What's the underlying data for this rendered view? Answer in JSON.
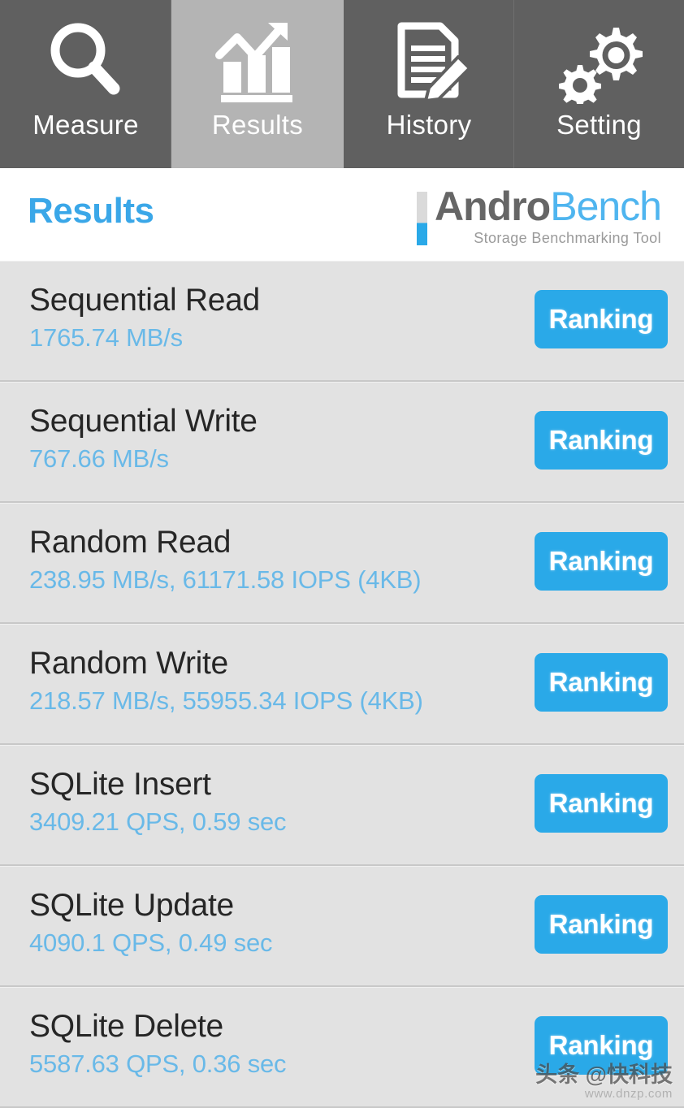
{
  "tabs": [
    {
      "label": "Measure",
      "icon": "magnifier-icon",
      "active": false
    },
    {
      "label": "Results",
      "icon": "bar-chart-trend-icon",
      "active": true
    },
    {
      "label": "History",
      "icon": "document-pencil-icon",
      "active": false
    },
    {
      "label": "Setting",
      "icon": "gears-icon",
      "active": false
    }
  ],
  "header": {
    "title": "Results",
    "logo_primary": "Andro",
    "logo_secondary": "Bench",
    "logo_tagline": "Storage Benchmarking Tool"
  },
  "results": [
    {
      "name": "Sequential Read",
      "value": "1765.74 MB/s",
      "button": "Ranking"
    },
    {
      "name": "Sequential Write",
      "value": "767.66 MB/s",
      "button": "Ranking"
    },
    {
      "name": "Random Read",
      "value": "238.95 MB/s, 61171.58 IOPS (4KB)",
      "button": "Ranking"
    },
    {
      "name": "Random Write",
      "value": "218.57 MB/s, 55955.34 IOPS (4KB)",
      "button": "Ranking"
    },
    {
      "name": "SQLite Insert",
      "value": "3409.21 QPS, 0.59 sec",
      "button": "Ranking"
    },
    {
      "name": "SQLite Update",
      "value": "4090.1 QPS, 0.49 sec",
      "button": "Ranking"
    },
    {
      "name": "SQLite Delete",
      "value": "5587.63 QPS, 0.36 sec",
      "button": "Ranking"
    }
  ],
  "watermark": {
    "main": "头条 @快科技",
    "sub": "www.dnzp.com"
  },
  "colors": {
    "accent_blue": "#2aa9e8",
    "value_blue": "#69b9e8",
    "title_blue": "#3aa7e8",
    "tab_inactive": "#606060",
    "tab_active": "#b4b4b4",
    "row_bg": "#e2e2e2",
    "row_divider": "#c8c8c8",
    "logo_gray": "#666666"
  }
}
